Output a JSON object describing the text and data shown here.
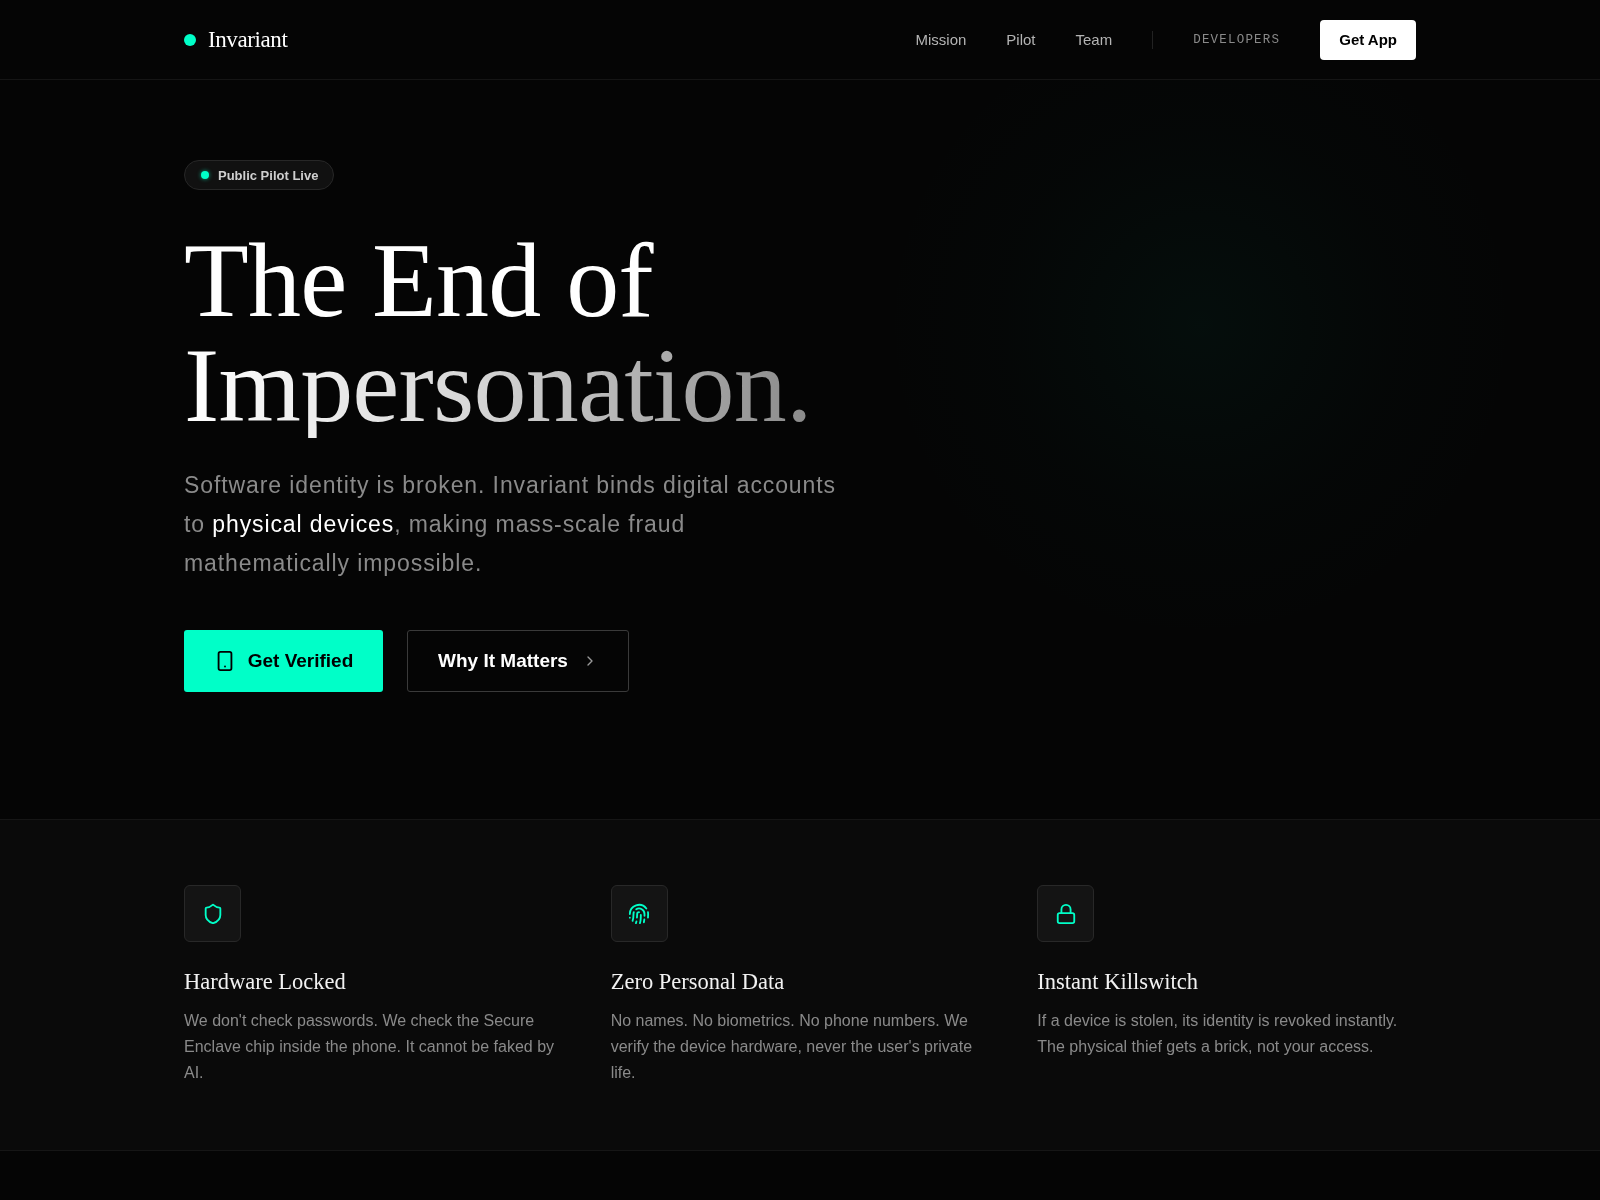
{
  "nav": {
    "logo": "Invariant",
    "links": [
      "Mission",
      "Pilot",
      "Team"
    ],
    "developers": "DEVELOPERS",
    "cta": "Get App"
  },
  "hero": {
    "badge": "Public Pilot Live",
    "heading": [
      {
        "text": "The End of",
        "kind": "plain"
      },
      {
        "text": "Impersonation.",
        "kind": "gradient"
      }
    ],
    "subtitle": [
      {
        "text": "Software identity is broken. Invariant binds digital accounts to ",
        "kind": "plain"
      },
      {
        "text": "physical devices",
        "kind": "highlight"
      },
      {
        "text": ", making mass-scale fraud mathematically impossible.",
        "kind": "plain"
      }
    ],
    "primary_button": "Get Verified",
    "secondary_button": "Why It Matters"
  },
  "features": [
    {
      "title": "Hardware Locked",
      "description": "We don't check passwords. We check the Secure Enclave chip inside the phone. It cannot be faked by AI."
    },
    {
      "title": "Zero Personal Data",
      "description": "No names. No biometrics. No phone numbers. We verify the device hardware, never the user's private life."
    },
    {
      "title": "Instant Killswitch",
      "description": "If a device is stolen, its identity is revoked instantly. The physical thief gets a brick, not your access."
    }
  ]
}
